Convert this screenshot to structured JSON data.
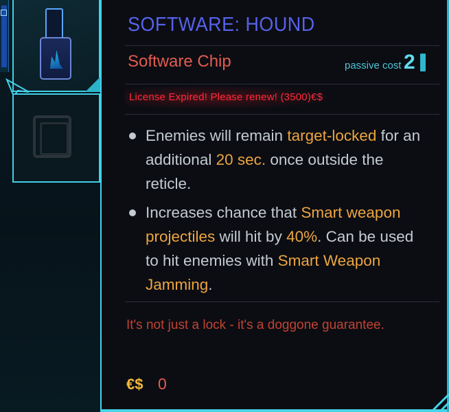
{
  "inventory": {
    "equipped_item_icon": "software-chip-icon",
    "empty_slot_icon": "empty-chip-slot-icon"
  },
  "tooltip": {
    "title": "SOFTWARE: HOUND",
    "subtitle": "Software Chip",
    "passive_cost_label": "passive cost",
    "passive_cost_value": "2",
    "license_warning": "License Expired! Please renew! (3500)€$",
    "bullets": [
      {
        "parts": [
          {
            "text": "Enemies will remain ",
            "highlight": false
          },
          {
            "text": "target-locked",
            "highlight": true
          },
          {
            "text": " for an additional ",
            "highlight": false
          },
          {
            "text": "20 sec.",
            "highlight": true
          },
          {
            "text": " once outside the reticle.",
            "highlight": false
          }
        ]
      },
      {
        "parts": [
          {
            "text": "Increases chance that ",
            "highlight": false
          },
          {
            "text": "Smart weapon projectiles",
            "highlight": true
          },
          {
            "text": " will hit by ",
            "highlight": false
          },
          {
            "text": "40%",
            "highlight": true
          },
          {
            "text": ". Can be used to hit enemies with ",
            "highlight": false
          },
          {
            "text": "Smart Weapon Jamming",
            "highlight": true
          },
          {
            "text": ".",
            "highlight": false
          }
        ]
      }
    ],
    "flavor_text": "It's not just a lock - it's a doggone guarantee.",
    "price_currency_icon": "€$",
    "price_value": "0"
  },
  "colors": {
    "accent_cyan": "#45d4ea",
    "title_blue": "#5662ea",
    "subtitle_red": "#e35c4e",
    "warning_red": "#ff2a3a",
    "highlight_orange": "#eda53f",
    "body_text": "#c4cbd0"
  }
}
